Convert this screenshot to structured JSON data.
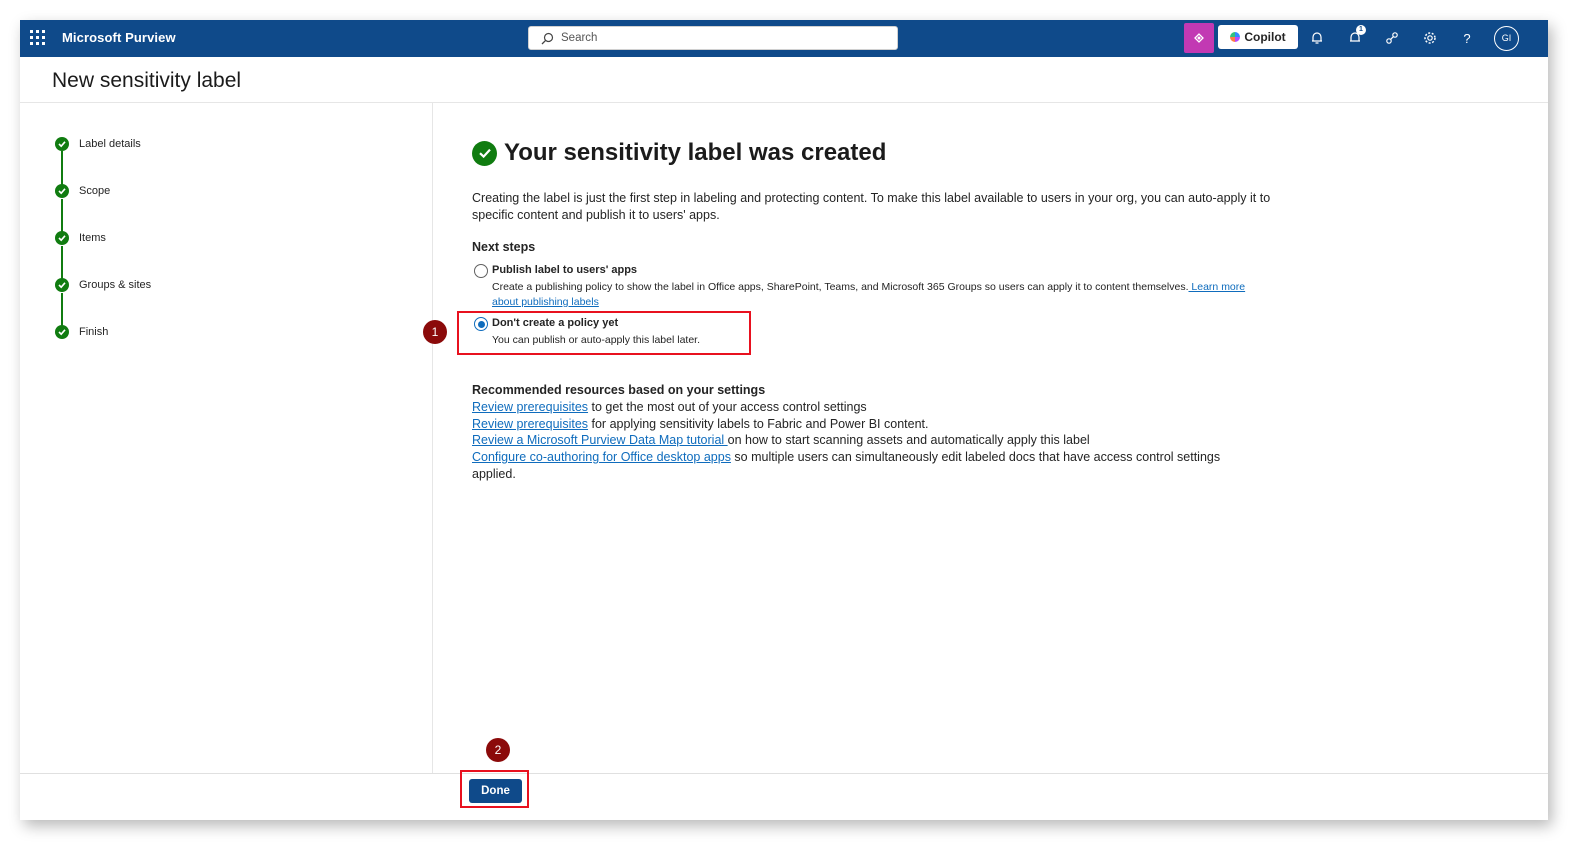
{
  "topbar": {
    "app_name": "Microsoft Purview",
    "search_placeholder": "Search",
    "copilot_label": "Copilot",
    "notification_count": "1",
    "avatar_initials": "GI"
  },
  "page": {
    "title": "New sensitivity label"
  },
  "steps": [
    {
      "label": "Label details"
    },
    {
      "label": "Scope"
    },
    {
      "label": "Items"
    },
    {
      "label": "Groups & sites"
    },
    {
      "label": "Finish"
    }
  ],
  "main": {
    "success_title": "Your sensitivity label was created",
    "intro": "Creating the label is just the first step in labeling and protecting content. To make this label available to users in your org, you can auto-apply it to specific content and publish it to users' apps.",
    "next_steps_heading": "Next steps",
    "options": [
      {
        "title": "Publish label to users' apps",
        "description": "Create a publishing policy to show the label in Office apps, SharePoint, Teams, and Microsoft 365 Groups so users can apply it to content themselves.",
        "link": " Learn more about publishing labels",
        "selected": false
      },
      {
        "title": "Don't create a policy yet",
        "description": "You can publish or auto-apply this label later.",
        "selected": true
      }
    ],
    "recommended_heading": "Recommended resources based on your settings",
    "resources": [
      {
        "link": "Review prerequisites",
        "text": " to get the most out of your access control settings"
      },
      {
        "link": "Review prerequisites",
        "text": " for applying sensitivity labels to Fabric and Power BI content."
      },
      {
        "link": "Review a Microsoft Purview Data Map tutorial ",
        "text": "on how to start scanning assets and automatically apply this label"
      },
      {
        "link": "Configure co-authoring for Office desktop apps",
        "text": " so multiple users can simultaneously edit labeled docs that have access control settings applied."
      }
    ]
  },
  "footer": {
    "done_label": "Done"
  },
  "annotations": [
    {
      "number": "1"
    },
    {
      "number": "2"
    }
  ],
  "colors": {
    "topbar": "#0f4a8a",
    "success_green": "#107c10",
    "link_blue": "#0f6cbd",
    "annotation_red": "#e8111f",
    "annotation_badge": "#8b0a0a",
    "copilot_pink": "#c239b3"
  }
}
